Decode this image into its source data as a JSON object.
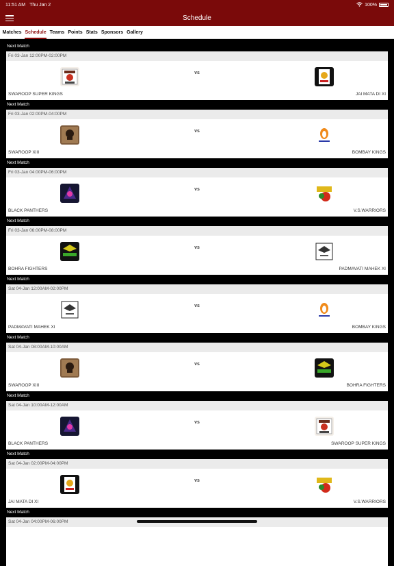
{
  "status": {
    "time": "11:51 AM",
    "date": "Thu Jan 2",
    "battery": "100%"
  },
  "nav": {
    "title": "Schedule"
  },
  "tabs": [
    {
      "label": "Matches"
    },
    {
      "label": "Schedule",
      "active": true
    },
    {
      "label": "Teams"
    },
    {
      "label": "Points"
    },
    {
      "label": "Stats"
    },
    {
      "label": "Sponsors"
    },
    {
      "label": "Gallery"
    }
  ],
  "matches": [
    {
      "header": "Next Match",
      "datetime": "Fri 03-Jan 12:00PM-02:00PM",
      "vs": "vs",
      "home": {
        "name": "SWAROOP SUPER KINGS",
        "logo": "kings-crest"
      },
      "away": {
        "name": "JAI MATA DI XI",
        "logo": "lion-crest"
      }
    },
    {
      "header": "Next Match",
      "datetime": "Fri 03-Jan 02:00PM-04:00PM",
      "vs": "vs",
      "home": {
        "name": "SWAROOP XIII",
        "logo": "skull-crest"
      },
      "away": {
        "name": "BOMBAY KINGS",
        "logo": "flame-crest"
      }
    },
    {
      "header": "Next Match",
      "datetime": "Fri 03-Jan 04:00PM-06:00PM",
      "vs": "vs",
      "home": {
        "name": "BLACK PANTHERS",
        "logo": "panther-crest"
      },
      "away": {
        "name": "V.S.WARRIORS",
        "logo": "warriors-crest"
      }
    },
    {
      "header": "Next Match",
      "datetime": "Fri 03-Jan 06:00PM-08:00PM",
      "vs": "vs",
      "home": {
        "name": "BOHRA FIGHTERS",
        "logo": "fighters-crest"
      },
      "away": {
        "name": "PADMAVATI MAHEK XI",
        "logo": "eagle-crest"
      }
    },
    {
      "header": "Next Match",
      "datetime": "Sat 04-Jan 12:00AM-02:00PM",
      "vs": "vs",
      "home": {
        "name": "PADMAVATI MAHEK XI",
        "logo": "eagle-crest"
      },
      "away": {
        "name": "BOMBAY KINGS",
        "logo": "flame-crest"
      }
    },
    {
      "header": "Next Match",
      "datetime": "Sat 04-Jan 08:00AM-10:00AM",
      "vs": "vs",
      "home": {
        "name": "SWAROOP XIII",
        "logo": "skull-crest"
      },
      "away": {
        "name": "BOHRA FIGHTERS",
        "logo": "fighters-crest"
      }
    },
    {
      "header": "Next Match",
      "datetime": "Sat 04-Jan 10:00AM-12:00AM",
      "vs": "vs",
      "home": {
        "name": "BLACK PANTHERS",
        "logo": "panther-crest"
      },
      "away": {
        "name": "SWAROOP SUPER KINGS",
        "logo": "kings-crest"
      }
    },
    {
      "header": "Next Match",
      "datetime": "Sat 04-Jan 02:00PM-04:00PM",
      "vs": "vs",
      "home": {
        "name": "JAI MATA DI XI",
        "logo": "lion-crest"
      },
      "away": {
        "name": "V.S.WARRIORS",
        "logo": "warriors-crest"
      }
    },
    {
      "header": "Next Match",
      "datetime": "Sat 04-Jan 04:00PM-06:00PM",
      "vs": "",
      "home": {
        "name": "",
        "logo": ""
      },
      "away": {
        "name": "",
        "logo": ""
      }
    }
  ]
}
